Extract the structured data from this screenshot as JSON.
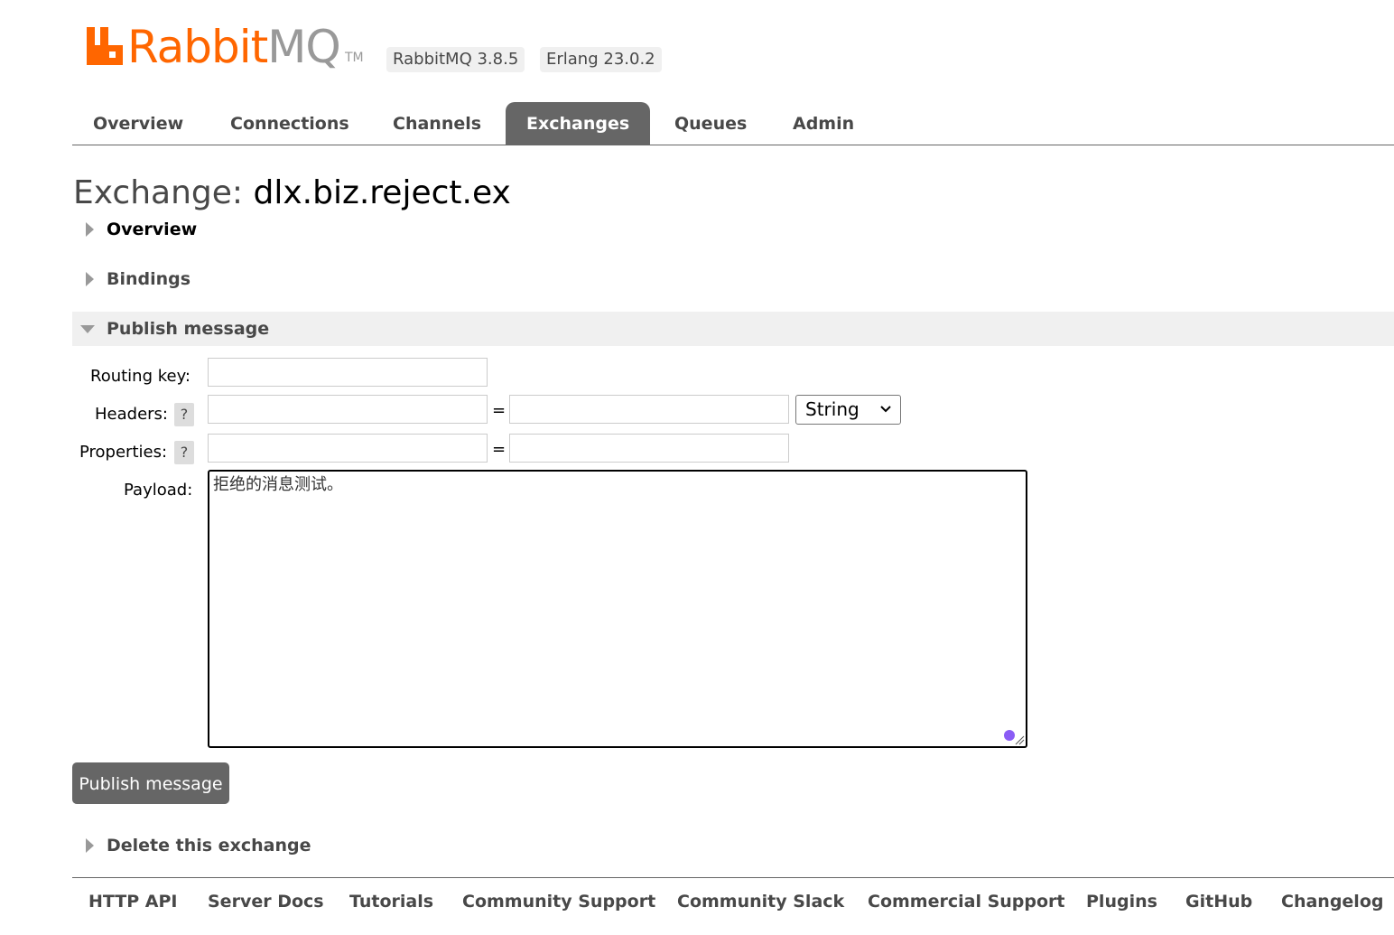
{
  "header": {
    "logo_text_1": "Rabbit",
    "logo_text_2": "MQ",
    "logo_tm": "TM",
    "rabbitmq_version": "RabbitMQ 3.8.5",
    "erlang_version": "Erlang 23.0.2"
  },
  "tabs": [
    {
      "label": "Overview",
      "selected": false
    },
    {
      "label": "Connections",
      "selected": false
    },
    {
      "label": "Channels",
      "selected": false
    },
    {
      "label": "Exchanges",
      "selected": true
    },
    {
      "label": "Queues",
      "selected": false
    },
    {
      "label": "Admin",
      "selected": false
    }
  ],
  "page": {
    "title_prefix": "Exchange:",
    "exchange_name": "dlx.biz.reject.ex"
  },
  "sections": {
    "overview": "Overview",
    "bindings": "Bindings",
    "publish": "Publish message",
    "delete": "Delete this exchange"
  },
  "form": {
    "routing_key_label": "Routing key:",
    "routing_key_value": "",
    "headers_label": "Headers:",
    "help": "?",
    "header_key_value": "",
    "header_value_value": "",
    "equals": "=",
    "header_type": "String",
    "properties_label": "Properties:",
    "property_key_value": "",
    "property_value_value": "",
    "payload_label": "Payload:",
    "payload_value": "拒绝的消息测试。",
    "publish_button": "Publish message"
  },
  "footer": {
    "links": [
      "HTTP API",
      "Server Docs",
      "Tutorials",
      "Community Support",
      "Community Slack",
      "Commercial Support",
      "Plugins",
      "GitHub",
      "Changelog"
    ]
  },
  "colors": {
    "brand_orange": "#ff6600",
    "tab_selected_bg": "#666666",
    "section_open_bg": "#f0f0f0"
  }
}
